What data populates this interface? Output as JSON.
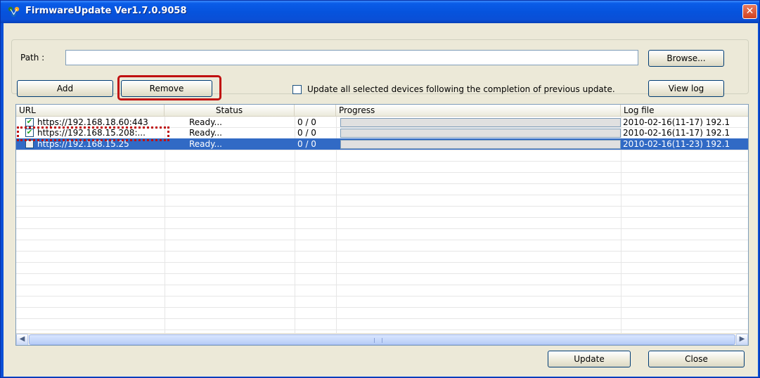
{
  "window": {
    "title": "FirmwareUpdate Ver1.7.0.9058",
    "close_glyph": "✕"
  },
  "path": {
    "label": "Path :",
    "value": "",
    "browse_label": "Browse..."
  },
  "toolbar": {
    "add_label": "Add",
    "remove_label": "Remove",
    "sequential_update_label": "Update all selected devices following the completion of previous update.",
    "sequential_update_checked": false,
    "view_log_label": "View log"
  },
  "device_list": {
    "columns": [
      "URL",
      "Status",
      "",
      "Progress",
      "Log file"
    ],
    "rows": [
      {
        "url": "https://192.168.18.60:443",
        "status": "Ready...",
        "count": "0 / 0",
        "progress": 0,
        "log": "2010-02-16(11-17) 192.1",
        "checked": true
      },
      {
        "url": "https://192.168.15.208:...",
        "status": "Ready...",
        "count": "0 / 0",
        "progress": 0,
        "log": "2010-02-16(11-17) 192.1",
        "checked": true
      },
      {
        "url": "https://192.168.15.25",
        "status": "Ready...",
        "count": "0 / 0",
        "progress": 0,
        "log": "2010-02-16(11-23) 192.1",
        "checked": false,
        "selected": true
      }
    ]
  },
  "footer": {
    "update_label": "Update",
    "close_label": "Close"
  },
  "colors": {
    "titlebar": "#0a4fd6",
    "selection": "#316ac5",
    "highlight": "#c01010"
  }
}
